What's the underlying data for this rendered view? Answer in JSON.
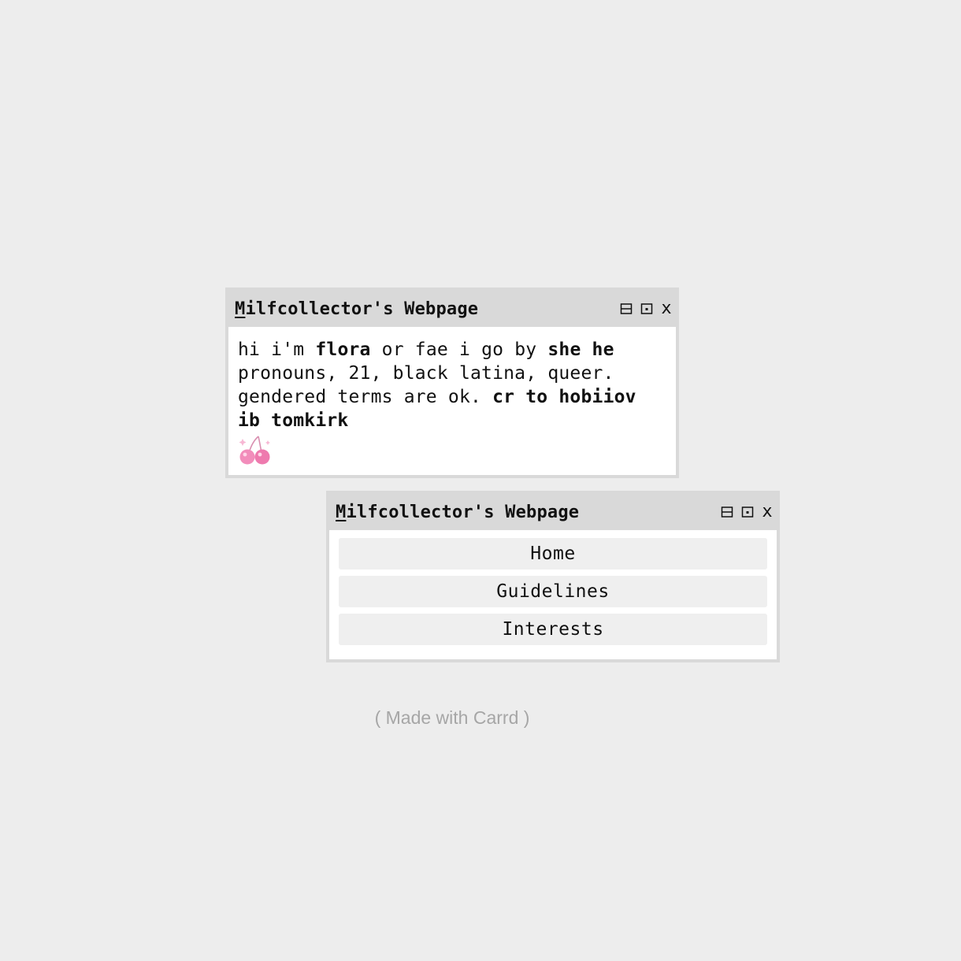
{
  "window_title_first": "M",
  "window_title_rest": "ilfcollector's Webpage",
  "controls": {
    "minimize_icon": "minimize-icon",
    "maximize_icon": "maximize-icon",
    "close_label": "x"
  },
  "intro": {
    "p1": "hi i'm ",
    "name": "flora",
    "p2": " or fae i go by ",
    "pronouns": "she he",
    "p3": " pronouns, 21, black latina, queer. gendered terms are ok. ",
    "credit": "cr to hobiiov ib tomkirk",
    "decoration_icon": "cherries-icon"
  },
  "nav": {
    "items": [
      {
        "label": "Home"
      },
      {
        "label": "Guidelines"
      },
      {
        "label": "Interests"
      }
    ]
  },
  "footer": {
    "text": "( Made with Carrd )"
  },
  "colors": {
    "background": "#ededed",
    "window_frame": "#d9d9d9",
    "button_bg": "#efefef",
    "footer_text": "#a6a6a6",
    "cherry": "#f07ab0"
  }
}
